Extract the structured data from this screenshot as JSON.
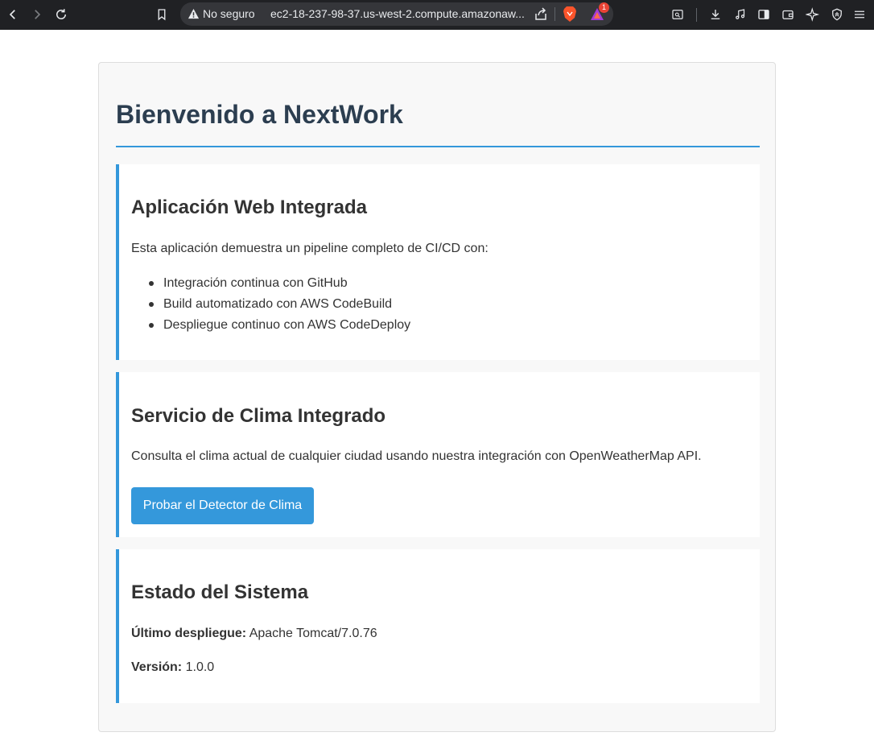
{
  "browser": {
    "security_label": "No seguro",
    "url": "ec2-18-237-98-37.us-west-2.compute.amazonaw...",
    "rewards_badge": "1"
  },
  "page": {
    "title": "Bienvenido a NextWork",
    "app_card": {
      "heading": "Aplicación Web Integrada",
      "intro": "Esta aplicación demuestra un pipeline completo de CI/CD con:",
      "items": [
        "Integración continua con GitHub",
        "Build automatizado con AWS CodeBuild",
        "Despliegue continuo con AWS CodeDeploy"
      ]
    },
    "weather_card": {
      "heading": "Servicio de Clima Integrado",
      "description": "Consulta el clima actual de cualquier ciudad usando nuestra integración con OpenWeatherMap API.",
      "button_label": "Probar el Detector de Clima"
    },
    "status_card": {
      "heading": "Estado del Sistema",
      "deploy_label": "Último despliegue:",
      "deploy_value": "Apache Tomcat/7.0.76",
      "version_label": "Versión:",
      "version_value": "1.0.0"
    }
  },
  "colors": {
    "accent": "#3498db",
    "title": "#2c3e50",
    "toolbar": "#202124"
  }
}
